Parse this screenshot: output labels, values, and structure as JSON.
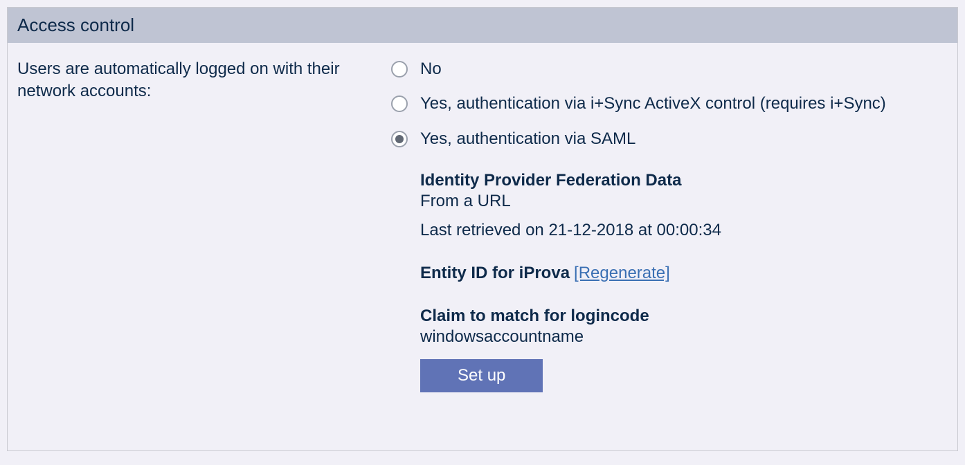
{
  "header": {
    "title": "Access control"
  },
  "question": "Users are automatically logged on with their network accounts:",
  "options": {
    "no": "No",
    "isync": "Yes, authentication via i+Sync ActiveX control (requires i+Sync)",
    "saml": "Yes, authentication via SAML"
  },
  "details": {
    "idp": {
      "heading": "Identity Provider Federation Data",
      "source": "From a URL",
      "retrieved": "Last retrieved on 21-12-2018 at 00:00:34"
    },
    "entity": {
      "heading": "Entity ID for iProva",
      "regenerate": "[Regenerate]"
    },
    "claim": {
      "heading": "Claim to match for logincode",
      "value": "windowsaccountname"
    },
    "setup_button": "Set up"
  }
}
